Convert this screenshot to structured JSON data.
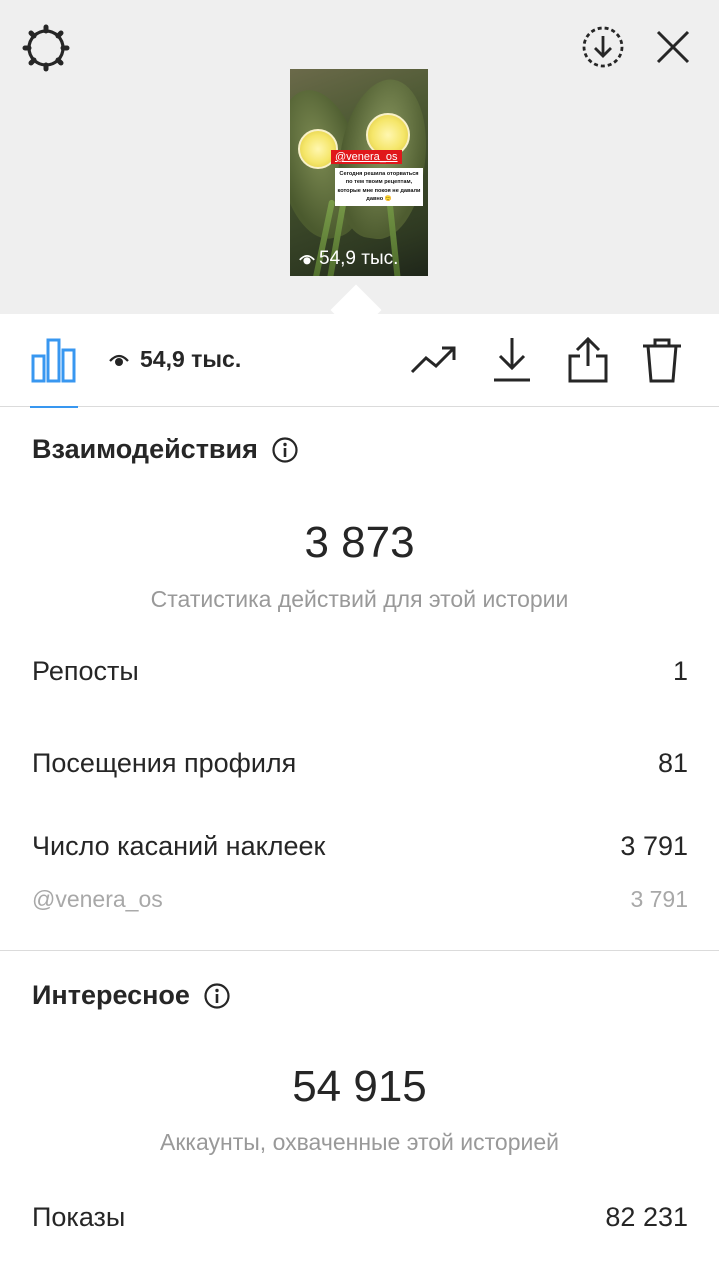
{
  "header": {
    "settings_icon": "gear-icon",
    "save_icon": "circle-download-icon",
    "close_icon": "close-icon"
  },
  "story": {
    "mention": "@venera_os",
    "caption": "Сегодня решила оторваться по тем твоим рецептам, которые мне покоя не давали давно 🙂",
    "views_label": "54,9 тыс."
  },
  "toolbar": {
    "views_count": "54,9 тыс.",
    "icons": [
      "bar-chart-icon",
      "eye-icon",
      "trend-arrow-icon",
      "download-icon",
      "share-icon",
      "trash-icon"
    ]
  },
  "interactions": {
    "title": "Взаимодействия",
    "total": "3 873",
    "caption": "Статистика действий для этой истории",
    "rows": [
      {
        "label": "Репосты",
        "value": "1"
      },
      {
        "label": "Посещения профиля",
        "value": "81"
      },
      {
        "label": "Число касаний наклеек",
        "value": "3 791"
      }
    ],
    "sub_row": {
      "label": "@venera_os",
      "value": "3 791"
    }
  },
  "discovery": {
    "title": "Интересное",
    "total": "54 915",
    "caption": "Аккаунты, охваченные этой историей",
    "rows": [
      {
        "label": "Показы",
        "value": "82 231"
      }
    ]
  },
  "colors": {
    "accent": "#3897f0",
    "mention_bg": "#e0171b",
    "top_bg": "#efefef",
    "muted_text": "#999999"
  }
}
